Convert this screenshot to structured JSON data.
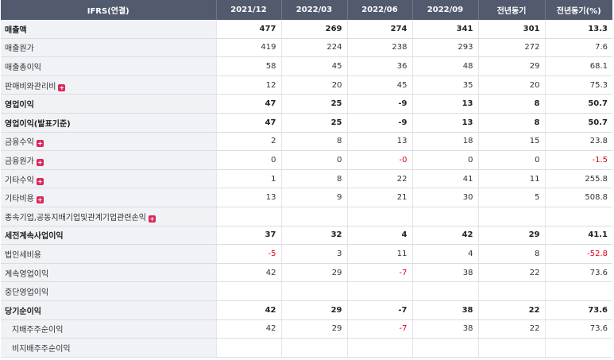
{
  "header": [
    "IFRS(연결)",
    "2021/12",
    "2022/03",
    "2022/06",
    "2022/09",
    "전년동기",
    "전년동기(%)"
  ],
  "rows": [
    {
      "label": "매출액",
      "bold": true,
      "expand": false,
      "indent": false,
      "values": [
        "477",
        "269",
        "274",
        "341",
        "301",
        "13.3"
      ]
    },
    {
      "label": "매출원가",
      "bold": false,
      "expand": false,
      "indent": false,
      "values": [
        "419",
        "224",
        "238",
        "293",
        "272",
        "7.6"
      ]
    },
    {
      "label": "매출총이익",
      "bold": false,
      "expand": false,
      "indent": false,
      "values": [
        "58",
        "45",
        "36",
        "48",
        "29",
        "68.1"
      ]
    },
    {
      "label": "판매비와관리비",
      "bold": false,
      "expand": true,
      "indent": false,
      "values": [
        "12",
        "20",
        "45",
        "35",
        "20",
        "75.3"
      ]
    },
    {
      "label": "영업이익",
      "bold": true,
      "expand": false,
      "indent": false,
      "values": [
        "47",
        "25",
        "-9",
        "13",
        "8",
        "50.7"
      ]
    },
    {
      "label": "영업이익(발표기준)",
      "bold": true,
      "expand": false,
      "indent": false,
      "values": [
        "47",
        "25",
        "-9",
        "13",
        "8",
        "50.7"
      ]
    },
    {
      "label": "금융수익",
      "bold": false,
      "expand": true,
      "indent": false,
      "values": [
        "2",
        "8",
        "13",
        "18",
        "15",
        "23.8"
      ]
    },
    {
      "label": "금융원가",
      "bold": false,
      "expand": true,
      "indent": false,
      "values": [
        "0",
        "0",
        "-0",
        "0",
        "0",
        "-1.5"
      ]
    },
    {
      "label": "기타수익",
      "bold": false,
      "expand": true,
      "indent": false,
      "values": [
        "1",
        "8",
        "22",
        "41",
        "11",
        "255.8"
      ]
    },
    {
      "label": "기타비용",
      "bold": false,
      "expand": true,
      "indent": false,
      "values": [
        "13",
        "9",
        "21",
        "30",
        "5",
        "508.8"
      ]
    },
    {
      "label": "종속기업,공동지배기업및관계기업관련손익",
      "bold": false,
      "expand": true,
      "indent": false,
      "values": [
        "",
        "",
        "",
        "",
        "",
        ""
      ]
    },
    {
      "label": "세전계속사업이익",
      "bold": true,
      "expand": false,
      "indent": false,
      "values": [
        "37",
        "32",
        "4",
        "42",
        "29",
        "41.1"
      ]
    },
    {
      "label": "법인세비용",
      "bold": false,
      "expand": false,
      "indent": false,
      "values": [
        "-5",
        "3",
        "11",
        "4",
        "8",
        "-52.8"
      ]
    },
    {
      "label": "계속영업이익",
      "bold": false,
      "expand": false,
      "indent": false,
      "values": [
        "42",
        "29",
        "-7",
        "38",
        "22",
        "73.6"
      ]
    },
    {
      "label": "중단영업이익",
      "bold": false,
      "expand": false,
      "indent": false,
      "values": [
        "",
        "",
        "",
        "",
        "",
        ""
      ]
    },
    {
      "label": "당기순이익",
      "bold": true,
      "expand": false,
      "indent": false,
      "values": [
        "42",
        "29",
        "-7",
        "38",
        "22",
        "73.6"
      ]
    },
    {
      "label": "지배주주순이익",
      "bold": false,
      "expand": false,
      "indent": true,
      "values": [
        "42",
        "29",
        "-7",
        "38",
        "22",
        "73.6"
      ]
    },
    {
      "label": "비지배주주순이익",
      "bold": false,
      "expand": false,
      "indent": true,
      "values": [
        "",
        "",
        "",
        "",
        "",
        ""
      ]
    }
  ],
  "icons": {
    "expand": "plus-square-icon"
  },
  "colors": {
    "header_bg": "#525a6e",
    "label_bg": "#f0f2f6",
    "negative": "#e0001a",
    "expand_icon": "#d8285a"
  }
}
